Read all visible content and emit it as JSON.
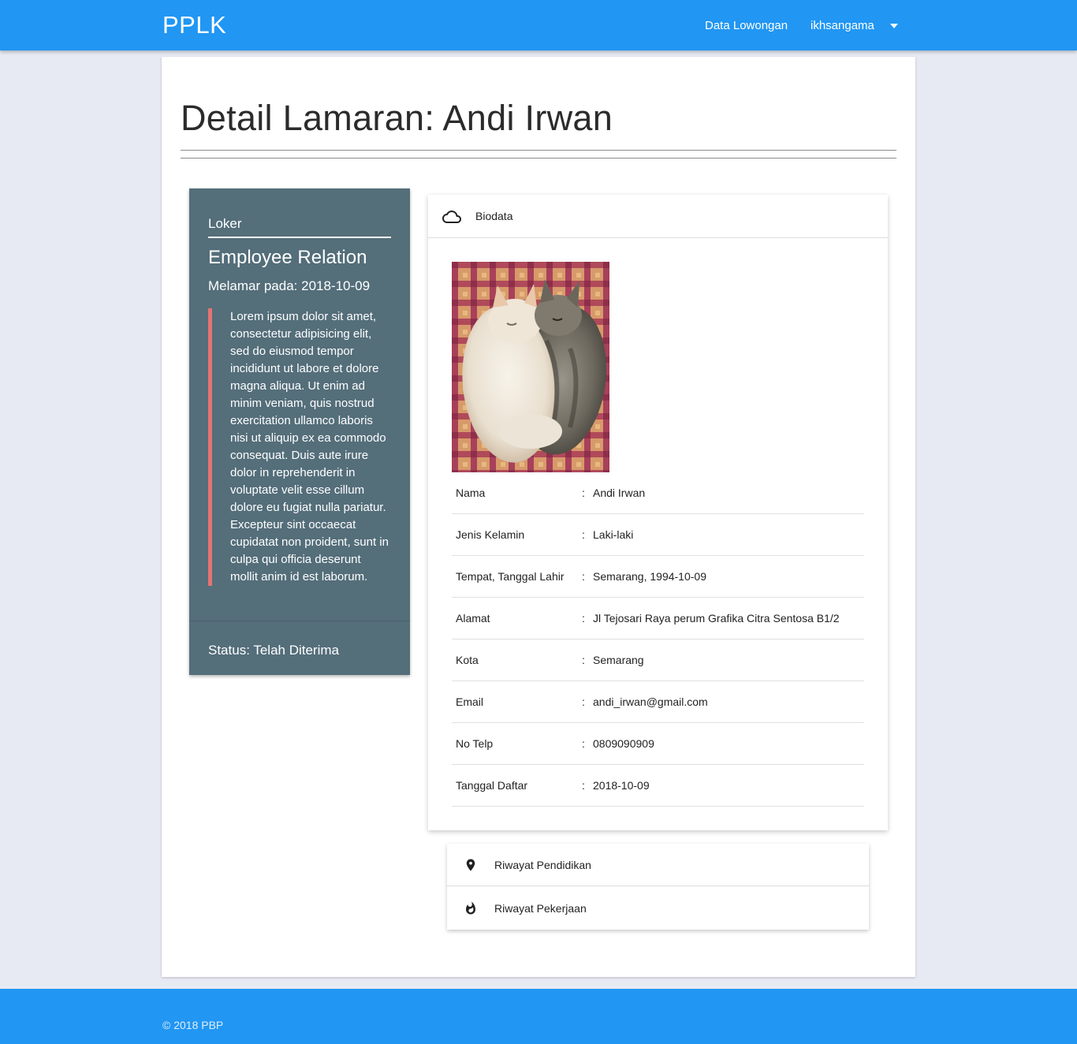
{
  "navbar": {
    "brand": "PPLK",
    "links": [
      {
        "label": "Data Lowongan"
      },
      {
        "label": "ikhsangama"
      }
    ],
    "dropdown_icon": "caret-down-icon"
  },
  "page": {
    "title": "Detail Lamaran: Andi Irwan"
  },
  "loker": {
    "label": "Loker",
    "position": "Employee Relation",
    "applied_date": "Melamar pada: 2018-10-09",
    "description": "Lorem ipsum dolor sit amet, consectetur adipisicing elit, sed do eiusmod tempor incididunt ut labore et dolore magna aliqua. Ut enim ad minim veniam, quis nostrud exercitation ullamco laboris nisi ut aliquip ex ea commodo consequat. Duis aute irure dolor in reprehenderit in voluptate velit esse cillum dolore eu fugiat nulla pariatur. Excepteur sint occaecat cupidatat non proident, sunt in culpa qui officia deserunt mollit anim id est laborum.",
    "status": "Status: Telah Diterima",
    "accent_color": "#e57373",
    "bg_color": "#546e7a"
  },
  "biodata": {
    "header": "Biodata",
    "header_icon": "cloud-icon",
    "photo_icon": "applicant-photo-cats",
    "separator": ":",
    "rows": [
      {
        "key": "Nama",
        "value": "Andi Irwan"
      },
      {
        "key": "Jenis Kelamin",
        "value": "Laki-laki"
      },
      {
        "key": "Tempat, Tanggal Lahir",
        "value": "Semarang, 1994-10-09"
      },
      {
        "key": "Alamat",
        "value": "Jl Tejosari Raya perum Grafika Citra Sentosa B1/2"
      },
      {
        "key": "Kota",
        "value": "Semarang"
      },
      {
        "key": "Email",
        "value": "andi_irwan@gmail.com"
      },
      {
        "key": "No Telp",
        "value": "0809090909"
      },
      {
        "key": "Tanggal Daftar",
        "value": "2018-10-09"
      }
    ]
  },
  "collapsible": {
    "items": [
      {
        "label": "Riwayat Pendidikan",
        "icon": "place-icon"
      },
      {
        "label": "Riwayat Pekerjaan",
        "icon": "whatshot-icon"
      }
    ]
  },
  "footer": {
    "text": "© 2018 PBP"
  },
  "colors": {
    "primary": "#2196f3",
    "background": "#e8eaf3"
  }
}
